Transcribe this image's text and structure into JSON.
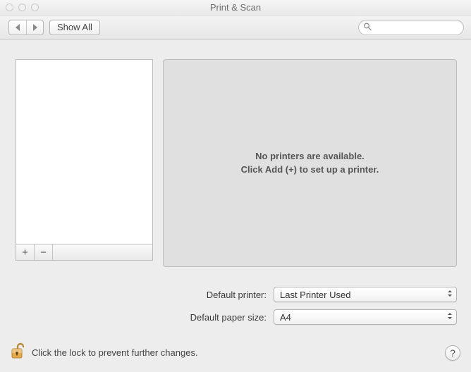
{
  "window": {
    "title": "Print & Scan"
  },
  "toolbar": {
    "show_all_label": "Show All",
    "search_placeholder": ""
  },
  "detail": {
    "empty_line1": "No printers are available.",
    "empty_line2": "Click Add (+) to set up a printer."
  },
  "defaults": {
    "printer_label": "Default printer:",
    "printer_value": "Last Printer Used",
    "paper_label": "Default paper size:",
    "paper_value": "A4"
  },
  "footer": {
    "lock_text": "Click the lock to prevent further changes."
  },
  "symbols": {
    "plus": "+",
    "minus": "−",
    "help": "?"
  }
}
